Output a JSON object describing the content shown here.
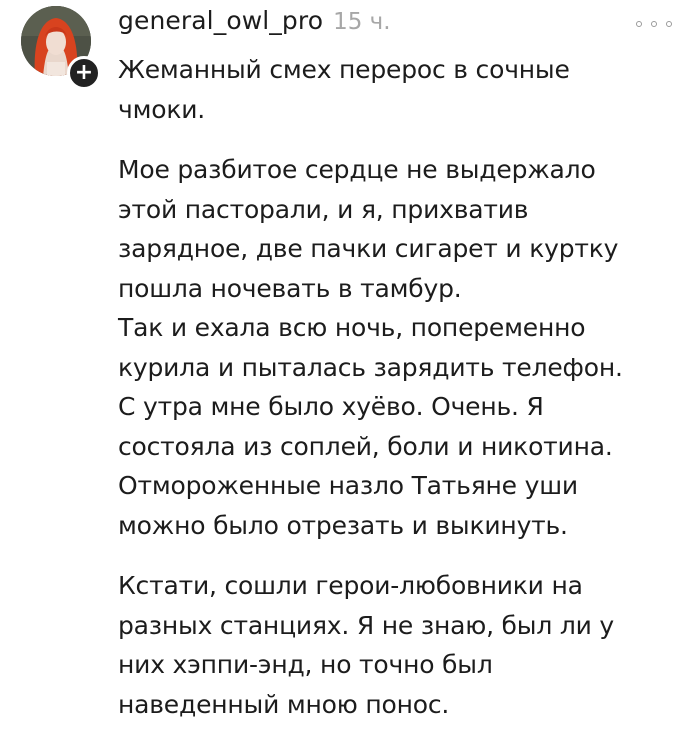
{
  "comment": {
    "author": "general_owl_pro",
    "time": "15 ч.",
    "follow_symbol": "+",
    "more_icon": "more-dots-icon",
    "paragraphs": [
      {
        "lines": [
          "Жеманный смех перерос в сочные",
          "чмоки."
        ]
      },
      {
        "lines": [
          "Мое разбитое сердце не выдержало",
          "этой пасторали, и я, прихватив",
          "зарядное, две пачки сигарет и куртку",
          "пошла ночевать в тамбур.",
          "Так и ехала всю ночь, попеременно",
          "курила и пыталась зарядить телефон.",
          "С утра мне было хуёво. Очень. Я",
          "состояла из соплей, боли и никотина.",
          "Отмороженные назло Татьяне уши",
          "можно было отрезать и выкинуть."
        ]
      },
      {
        "lines": [
          "Кстати, сошли герои-любовники на",
          "разных станциях. Я не знаю, был ли у",
          "них хэппи-энд, но точно был",
          "наведенный мною понос."
        ]
      }
    ]
  },
  "colors": {
    "text": "#1c1c1c",
    "muted": "#a7a7a7",
    "badge": "#222222",
    "avatar_hair": "#d8431f"
  }
}
